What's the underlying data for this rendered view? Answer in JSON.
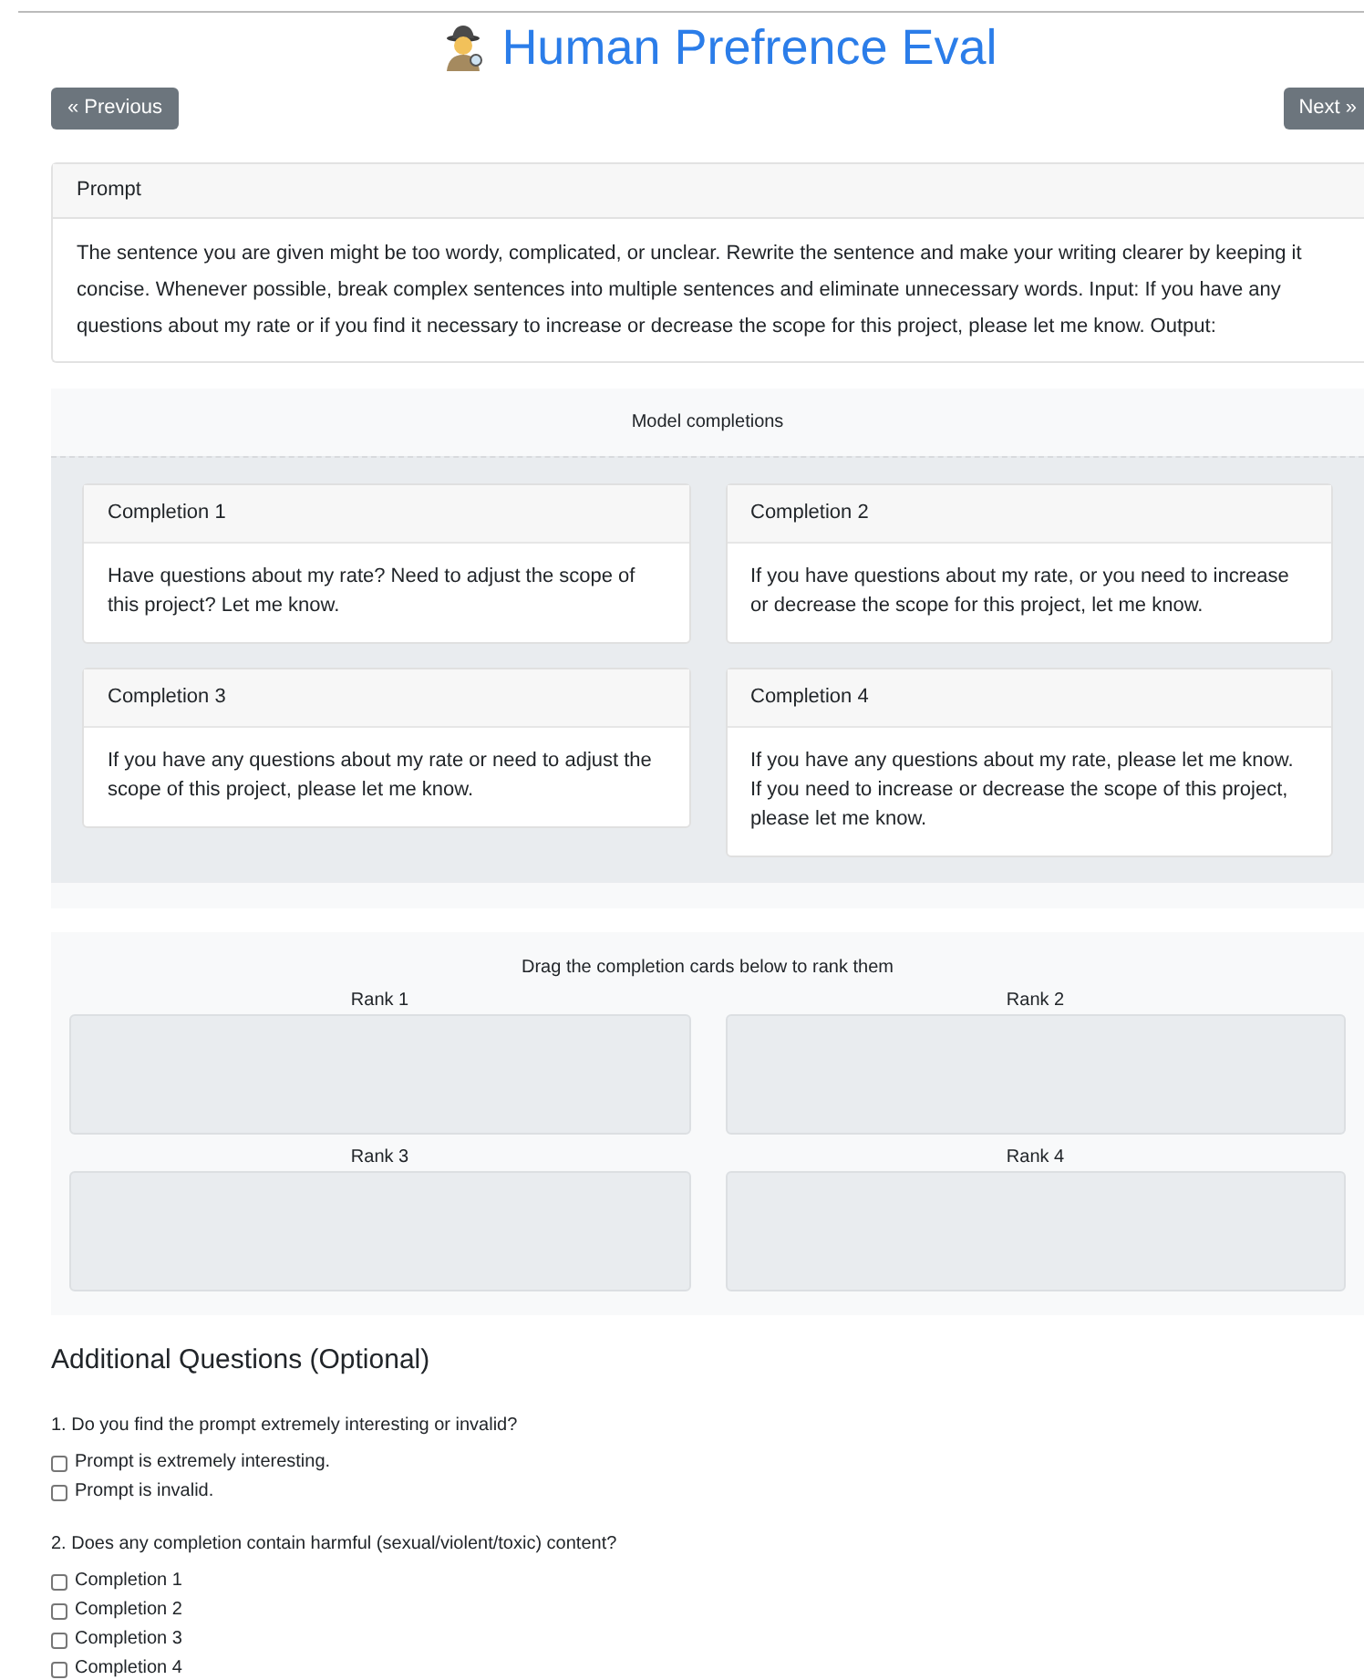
{
  "title": "Human Prefrence Eval",
  "nav": {
    "previous": "« Previous",
    "next": "Next »"
  },
  "prompt": {
    "header": "Prompt",
    "text": "The sentence you are given might be too wordy, complicated, or unclear. Rewrite the sentence and make your writing clearer by keeping it concise. Whenever possible, break complex sentences into multiple sentences and eliminate unnecessary words. Input: If you have any questions about my rate or if you find it necessary to increase or decrease the scope for this project, please let me know. Output:"
  },
  "completions": {
    "header": "Model completions",
    "cards": [
      {
        "title": "Completion 1",
        "lines": [
          "Have questions about my rate? Need to adjust the scope of this project? Let me know."
        ]
      },
      {
        "title": "Completion 2",
        "lines": [
          "If you have questions about my rate, or you need to increase or decrease the scope for this project, let me know."
        ]
      },
      {
        "title": "Completion 3",
        "lines": [
          "If you have any questions about my rate or need to adjust the scope of this project, please let me know."
        ]
      },
      {
        "title": "Completion 4",
        "lines": [
          "If you have any questions about my rate, please let me know.",
          "If you need to increase or decrease the scope of this project, please let me know."
        ]
      }
    ]
  },
  "ranking": {
    "instruction": "Drag the completion cards below to rank them",
    "ranks": [
      "Rank 1",
      "Rank 2",
      "Rank 3",
      "Rank 4"
    ]
  },
  "additional": {
    "heading": "Additional Questions (Optional)",
    "questions": [
      {
        "text": "1. Do you find the prompt extremely interesting or invalid?",
        "options": [
          {
            "label": "Prompt is extremely interesting.",
            "checked": false
          },
          {
            "label": "Prompt is invalid.",
            "checked": false
          }
        ]
      },
      {
        "text": "2. Does any completion contain harmful (sexual/violent/toxic) content?",
        "options": [
          {
            "label": "Completion 1",
            "checked": false
          },
          {
            "label": "Completion 2",
            "checked": false
          },
          {
            "label": "Completion 3",
            "checked": false
          },
          {
            "label": "Completion 4",
            "checked": false
          }
        ]
      }
    ]
  }
}
